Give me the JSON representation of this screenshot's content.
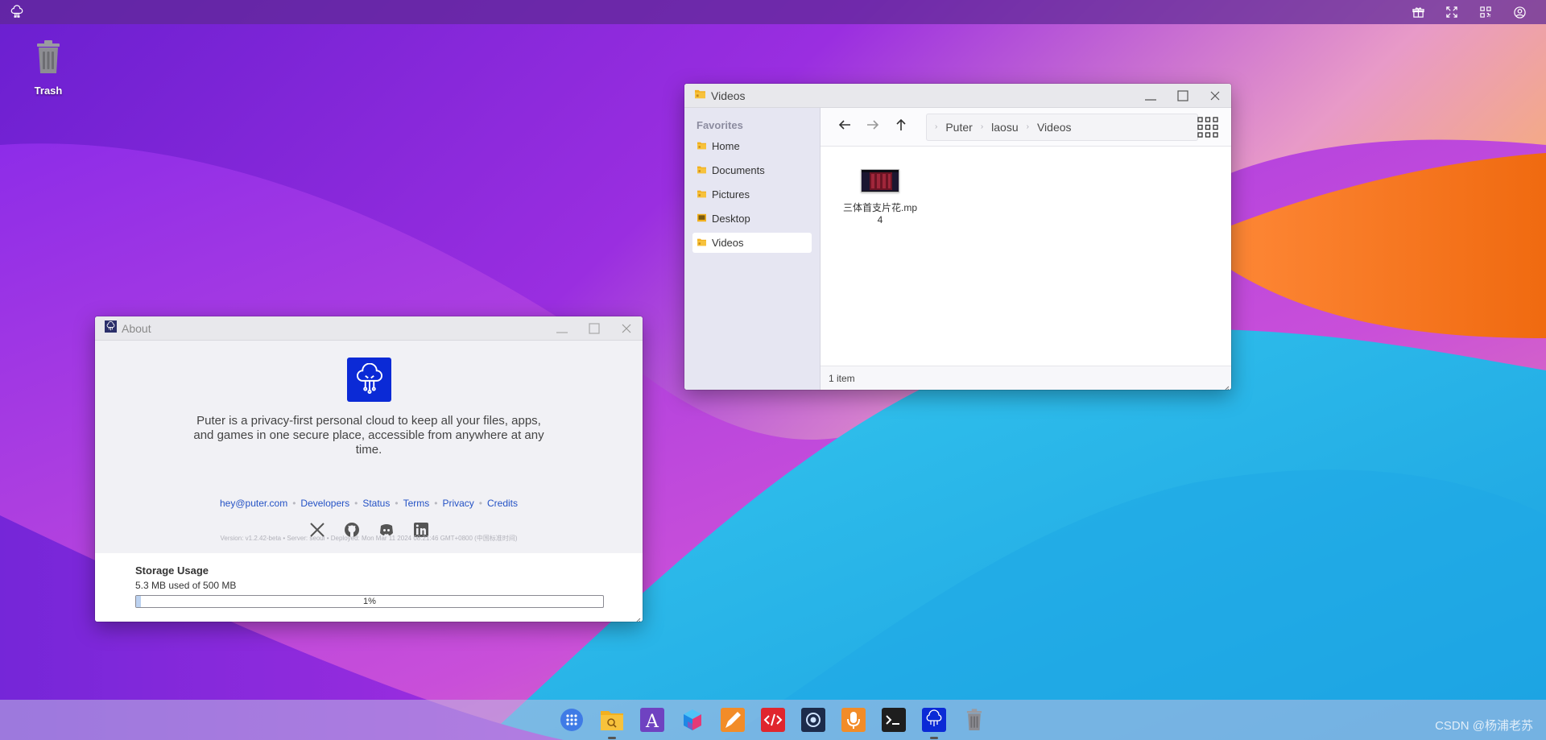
{
  "desktop": {
    "trash_label": "Trash"
  },
  "videos_window": {
    "title": "Videos",
    "favorites_heading": "Favorites",
    "sidebar": [
      {
        "label": "Home"
      },
      {
        "label": "Documents"
      },
      {
        "label": "Pictures"
      },
      {
        "label": "Desktop"
      },
      {
        "label": "Videos",
        "active": true
      }
    ],
    "breadcrumbs": [
      "Puter",
      "laosu",
      "Videos"
    ],
    "files": [
      {
        "name": "三体首支片花.mp4",
        "name_line1": "三体首支片花.mp",
        "name_line2": "4"
      }
    ],
    "status": "1 item"
  },
  "about_window": {
    "title": "About",
    "description": "Puter is a privacy-first personal cloud to keep all your files, apps, and games in one secure place, accessible from anywhere at any time.",
    "links": [
      "hey@puter.com",
      "Developers",
      "Status",
      "Terms",
      "Privacy",
      "Credits"
    ],
    "social_icons": [
      "x-icon",
      "github-icon",
      "discord-icon",
      "linkedin-icon"
    ],
    "version": "Version: v1.2.42-beta • Server: seoul • Deployed: Mon Mar 11 2024 08:21:46 GMT+0800 (中国标准时间)",
    "storage": {
      "heading": "Storage Usage",
      "used_text": "5.3 MB used of 500 MB",
      "percent_label": "1%",
      "fraction": 0.01
    }
  },
  "taskbar": {
    "apps": [
      "app-launcher-icon",
      "file-explorer-icon",
      "text-editor-icon",
      "cube-app-icon",
      "paint-app-icon",
      "code-editor-icon",
      "camera-app-icon",
      "recorder-app-icon",
      "terminal-icon",
      "puter-about-icon",
      "trash-icon"
    ]
  },
  "watermark": "CSDN @杨浦老苏",
  "colors": {
    "accent": "#0b2ad6",
    "link": "#2452c5",
    "folder": "#f2b01e"
  }
}
